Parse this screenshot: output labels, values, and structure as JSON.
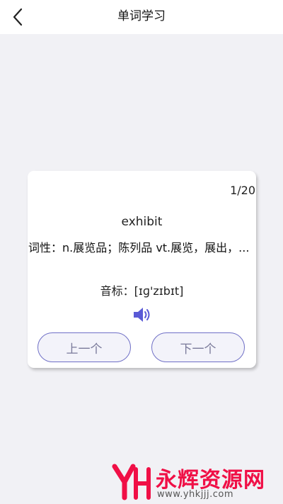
{
  "header": {
    "title": "单词学习",
    "back_icon": "chevron-left-icon"
  },
  "card": {
    "counter": "1/20",
    "word": "exhibit",
    "pos_line": "词性：n.展览品；陈列品 vt.展览，展出，...",
    "phonetic": "音标：[ɪɡ'zɪbɪt]",
    "speaker_icon": "speaker-icon",
    "prev_label": "上一个",
    "next_label": "下一个"
  },
  "watermark": {
    "name": "永辉资源网",
    "url": "www.yhkjjj.com"
  },
  "colors": {
    "accent": "#6f6fc6",
    "speaker": "#5a5ad6",
    "watermark": "#f00f46"
  }
}
